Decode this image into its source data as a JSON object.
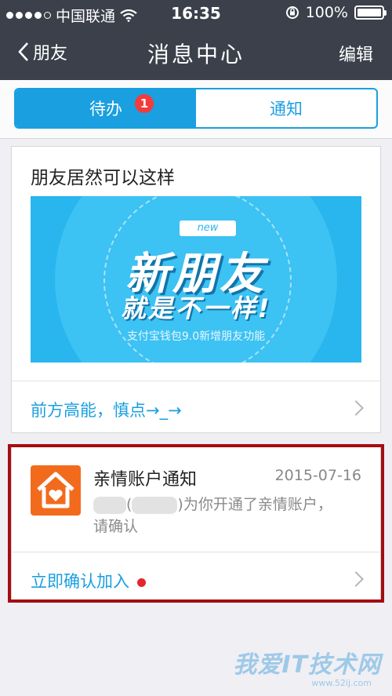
{
  "status_bar": {
    "carrier": "中国联通",
    "time": "16:35",
    "battery": "100%"
  },
  "nav": {
    "back_label": "朋友",
    "title": "消息中心",
    "edit_label": "编辑"
  },
  "tabs": [
    {
      "label": "待办",
      "badge": "1",
      "active": true
    },
    {
      "label": "通知",
      "active": false
    }
  ],
  "card1": {
    "title": "朋友居然可以这样",
    "banner": {
      "tag": "new",
      "line1": "新朋友",
      "line2": "就是不一样!",
      "subtitle": "支付宝钱包9.0新增朋友功能"
    },
    "link": "前方高能，慎点→_→"
  },
  "card2": {
    "icon": "home-heart-icon",
    "title": "亲情账户通知",
    "date": "2015-07-16",
    "body_paren_close": "",
    "body_text": "为你开通了亲情账户，",
    "body_text2": "请确认",
    "action": "立即确认加入"
  },
  "watermark": {
    "text": "我爱IT技术网",
    "url": "www.52ij.com"
  },
  "colors": {
    "accent": "#1a9fe0",
    "nav_bg": "#3b404a",
    "badge": "#f43b3b",
    "highlight": "#a40d12",
    "icon_bg": "#f26b1d"
  }
}
